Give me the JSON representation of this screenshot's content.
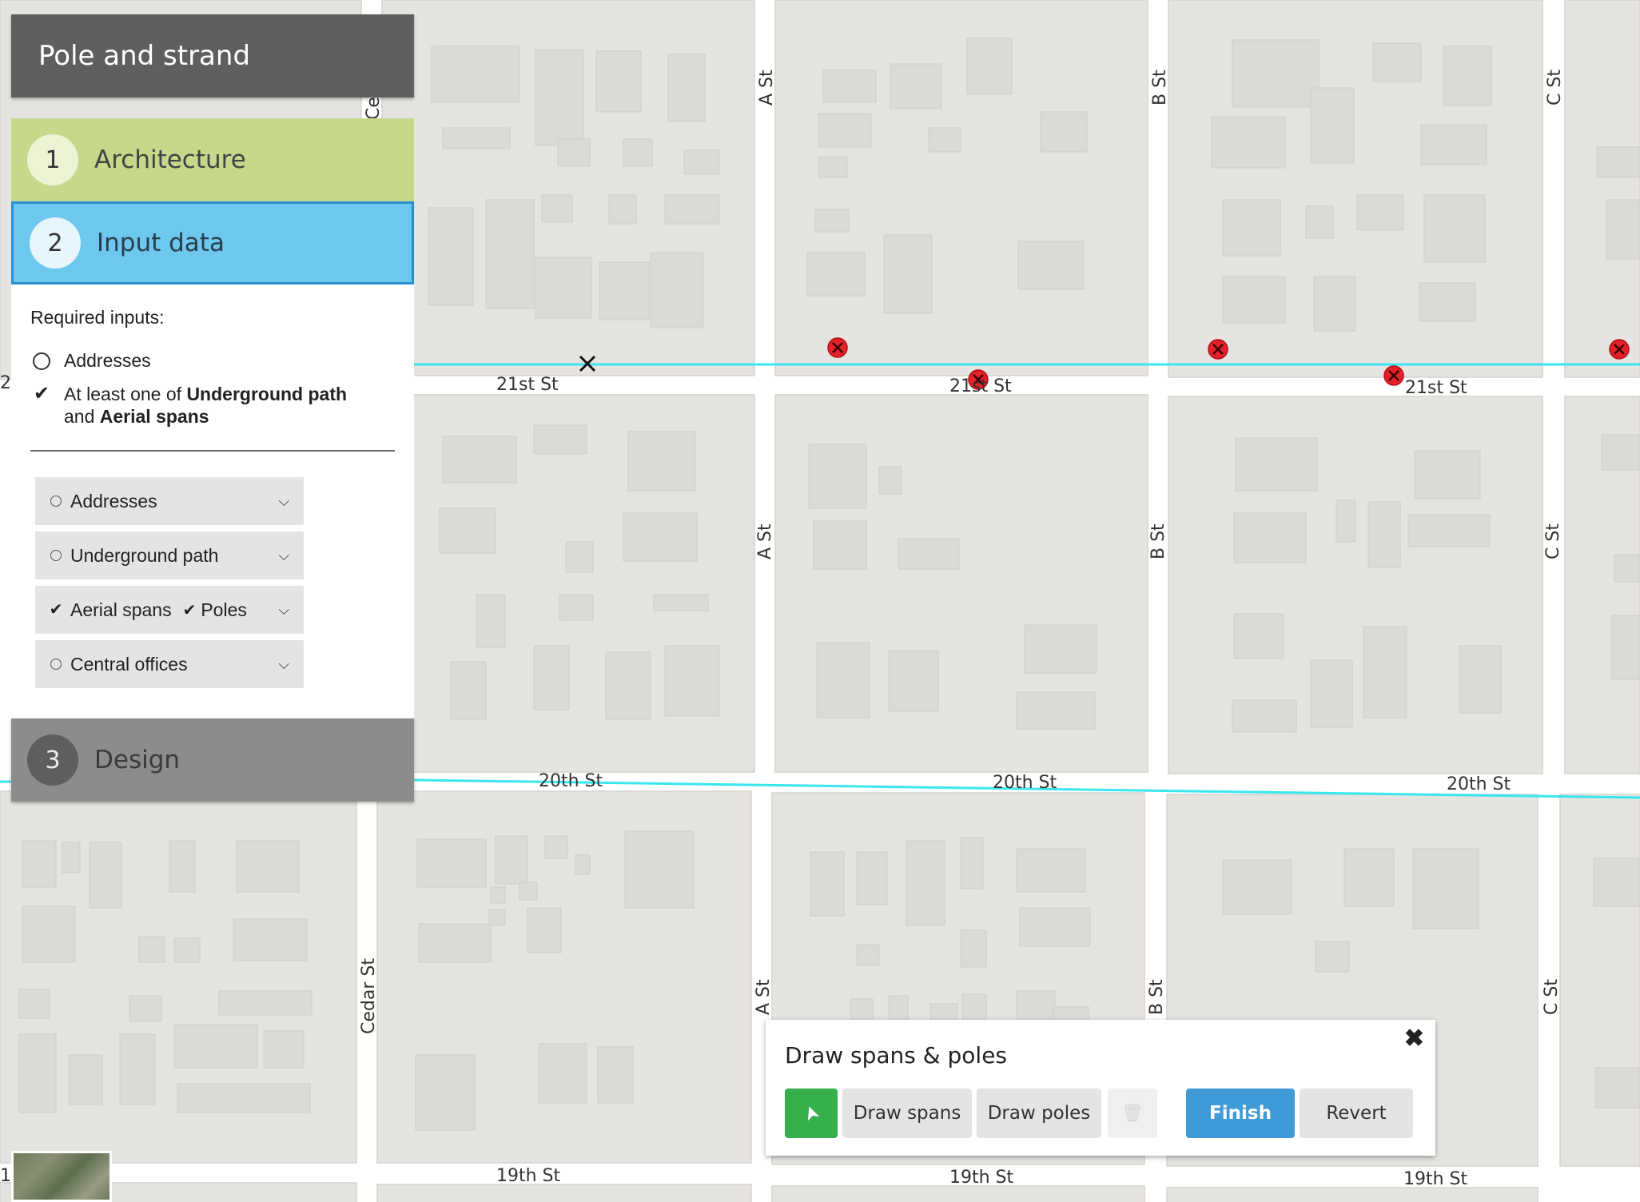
{
  "app": {
    "title": "Pole and strand"
  },
  "steps": [
    {
      "num": "1",
      "label": "Architecture"
    },
    {
      "num": "2",
      "label": "Input data"
    },
    {
      "num": "3",
      "label": "Design"
    }
  ],
  "inputs": {
    "required_title": "Required inputs:",
    "req_addresses": "Addresses",
    "req_path_pre": "At least one of ",
    "req_path_bold1": "Underground path",
    "req_path_mid": "and ",
    "req_path_bold2": "Aerial spans",
    "layers": [
      {
        "label": "Addresses",
        "checked": false
      },
      {
        "label": "Underground path",
        "checked": false
      },
      {
        "label": "Aerial spans",
        "checked": true,
        "sub_label": "Poles",
        "sub_checked": true
      },
      {
        "label": "Central offices",
        "checked": false
      }
    ]
  },
  "draw_panel": {
    "title": "Draw spans & poles",
    "close_glyph": "✖",
    "select_glyph": "➤",
    "draw_spans": "Draw spans",
    "draw_poles": "Draw poles",
    "delete_glyph": "🗑",
    "finish": "Finish",
    "revert": "Revert"
  },
  "map": {
    "streets": {
      "cedar": "Cedar St",
      "a": "A St",
      "b": "B St",
      "c": "C St",
      "st21": "21st St",
      "st20": "20th St",
      "st19": "19th St",
      "edge_left_top": "2",
      "edge_left_bottom": "1"
    },
    "line_color": "#39e6f0",
    "pole_color": "#e4202a"
  },
  "icons": {
    "select": "cursor-arrow-icon",
    "delete": "trash-icon",
    "close": "close-icon",
    "chevron": "chevron-down-icon",
    "check": "checkmark-icon"
  }
}
